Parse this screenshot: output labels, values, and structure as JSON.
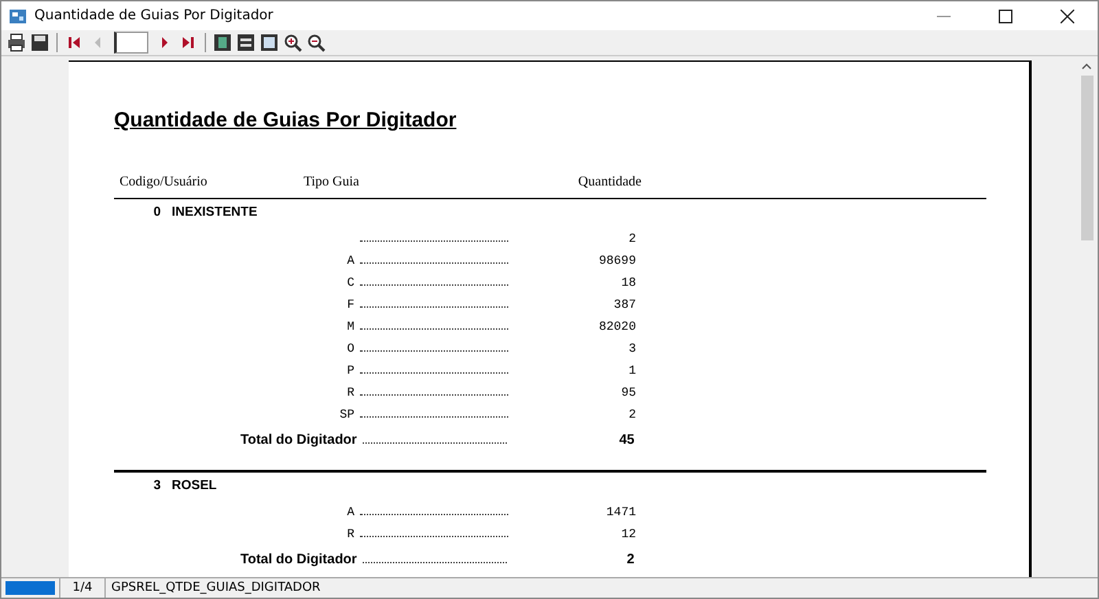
{
  "window": {
    "title": "Quantidade de Guias Por Digitador"
  },
  "toolbar": {
    "prev_disabled": true
  },
  "report": {
    "title": "Quantidade de Guias Por Digitador",
    "columns": [
      "Codigo/Usuário",
      "Tipo Guia",
      "Quantidade"
    ],
    "groups": [
      {
        "code": "0",
        "name": "INEXISTENTE",
        "rows": [
          {
            "quantity": "2"
          },
          {
            "type": "A",
            "quantity": "98699"
          },
          {
            "type": "C",
            "quantity": "18"
          },
          {
            "type": "F",
            "quantity": "387"
          },
          {
            "type": "M",
            "quantity": "82020"
          },
          {
            "type": "O",
            "quantity": "3"
          },
          {
            "type": "P",
            "quantity": "1"
          },
          {
            "type": "R",
            "quantity": "95"
          },
          {
            "type": "SP",
            "quantity": "2"
          }
        ],
        "total_label": "Total do Digitador",
        "total": "45"
      },
      {
        "code": "3",
        "name": "ROSEL",
        "rows": [
          {
            "type": "A",
            "quantity": "1471"
          },
          {
            "type": "R",
            "quantity": "12"
          }
        ],
        "total_label": "Total do Digitador",
        "total": "2"
      }
    ]
  },
  "status_bar": {
    "progress": {
      "level": 1
    },
    "page": "1/4",
    "report_name": "GPSREL_QTDE_GUIAS_DIGITADOR"
  }
}
